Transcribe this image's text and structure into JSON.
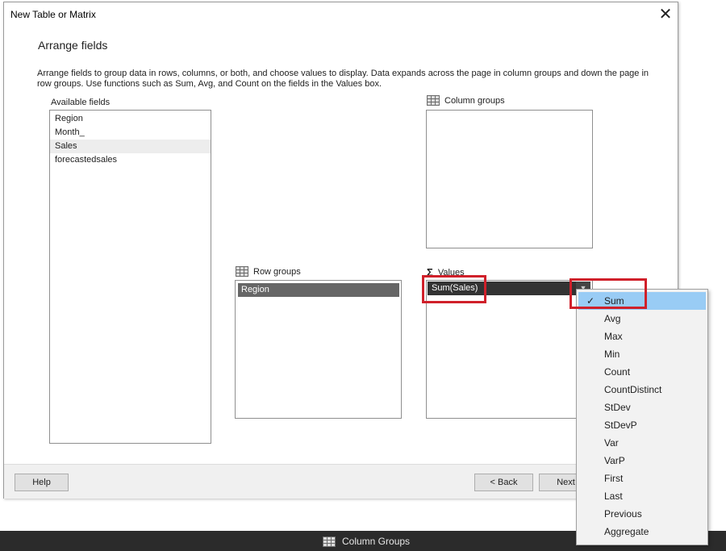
{
  "dialog": {
    "title": "New Table or Matrix",
    "heading": "Arrange fields",
    "description": "Arrange fields to group data in rows, columns, or both, and choose values to display. Data expands across the page in column groups and down the page in row groups.  Use functions such as Sum, Avg, and Count on the fields in the Values box.",
    "close_icon": "close-icon"
  },
  "available_fields": {
    "label": "Available fields",
    "items": [
      "Region",
      "Month_",
      "Sales",
      "forecastedsales"
    ]
  },
  "column_groups": {
    "label": "Column groups",
    "icon": "grid-icon"
  },
  "row_groups": {
    "label": "Row groups",
    "icon": "grid-icon",
    "items": [
      "Region"
    ]
  },
  "values": {
    "label": "Values",
    "icon": "sigma-icon",
    "items": [
      "Sum(Sales)"
    ]
  },
  "footer": {
    "help": "Help",
    "back": "< Back",
    "next": "Next"
  },
  "aggregate_menu": {
    "selected": "Sum",
    "items": [
      "Sum",
      "Avg",
      "Max",
      "Min",
      "Count",
      "CountDistinct",
      "StDev",
      "StDevP",
      "Var",
      "VarP",
      "First",
      "Last",
      "Previous",
      "Aggregate"
    ]
  },
  "bottom_bar": {
    "label": "Column Groups"
  },
  "highlight_color": "#d0202a"
}
